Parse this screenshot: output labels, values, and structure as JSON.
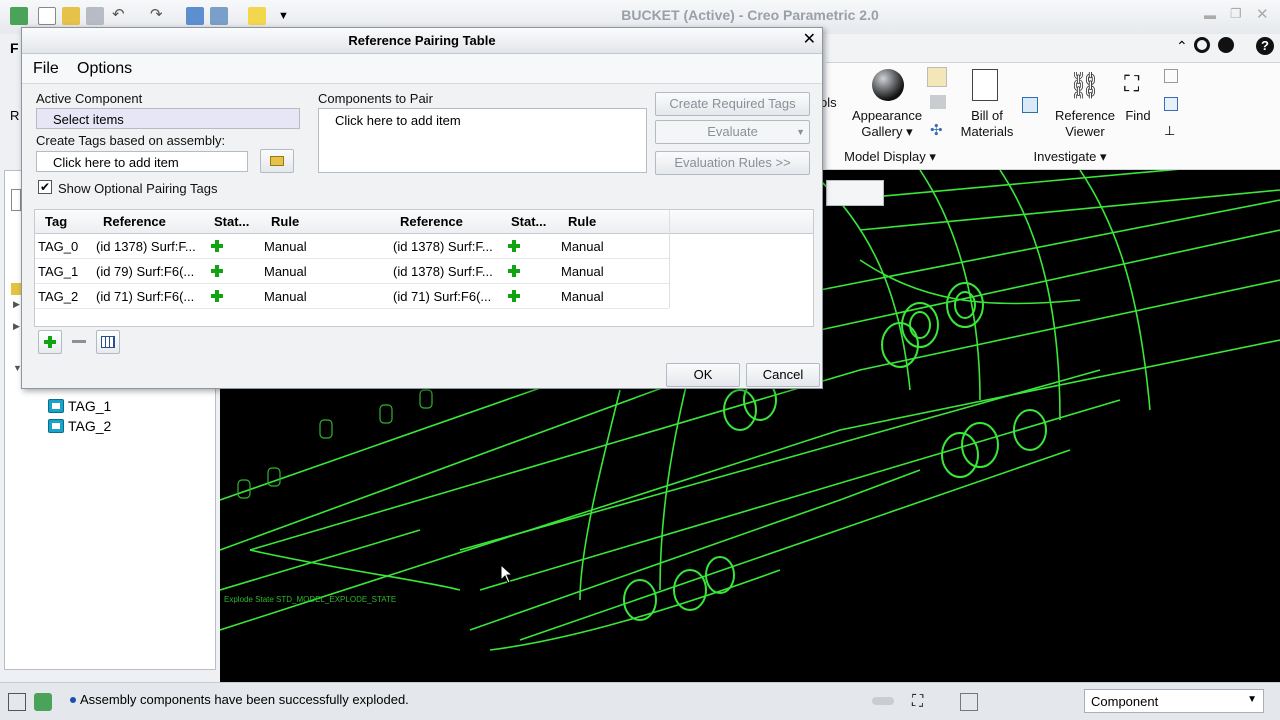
{
  "app": {
    "title": "BUCKET (Active) - Creo Parametric 2.0"
  },
  "ribbon": {
    "appearance_gallery": "Appearance\nGallery ▾",
    "bill_of_materials": "Bill of\nMaterials",
    "reference_viewer": "Reference\nViewer",
    "find": "Find",
    "group_model_display": "Model Display ▾",
    "group_investigate": "Investigate ▾",
    "tools_fragment": "ols"
  },
  "tree": {
    "items": [
      {
        "label": "TAG_1"
      },
      {
        "label": "TAG_2"
      }
    ]
  },
  "canvas": {
    "overlay_text": "Explode State STD_MODEL_EXPLODE_STATE"
  },
  "status": {
    "message": "Assembly components have been successfully exploded.",
    "filter": "Component"
  },
  "dialog": {
    "title": "Reference Pairing Table",
    "menu": {
      "file": "File",
      "options": "Options"
    },
    "active_component_label": "Active Component",
    "active_component_value": "Select items",
    "create_tags_label": "Create Tags based on assembly:",
    "create_tags_value": "Click here to add item",
    "components_to_pair_label": "Components to Pair",
    "components_to_pair_value": "Click here to add item",
    "create_required_tags": "Create Required Tags",
    "evaluate": "Evaluate",
    "evaluation_rules": "Evaluation Rules >>",
    "show_optional": "Show Optional Pairing Tags",
    "columns": [
      "Tag",
      "Reference",
      "Stat...",
      "Rule",
      "Reference",
      "Stat...",
      "Rule"
    ],
    "rows": [
      {
        "tag": "TAG_0",
        "ref1": "(id 1378) Surf:F...",
        "rule1": "Manual",
        "ref2": "(id 1378) Surf:F...",
        "rule2": "Manual"
      },
      {
        "tag": "TAG_1",
        "ref1": "(id 79) Surf:F6(...",
        "rule1": "Manual",
        "ref2": "(id 1378) Surf:F...",
        "rule2": "Manual"
      },
      {
        "tag": "TAG_2",
        "ref1": "(id 71) Surf:F6(...",
        "rule1": "Manual",
        "ref2": "(id 71) Surf:F6(...",
        "rule2": "Manual"
      }
    ],
    "ok": "OK",
    "cancel": "Cancel"
  }
}
